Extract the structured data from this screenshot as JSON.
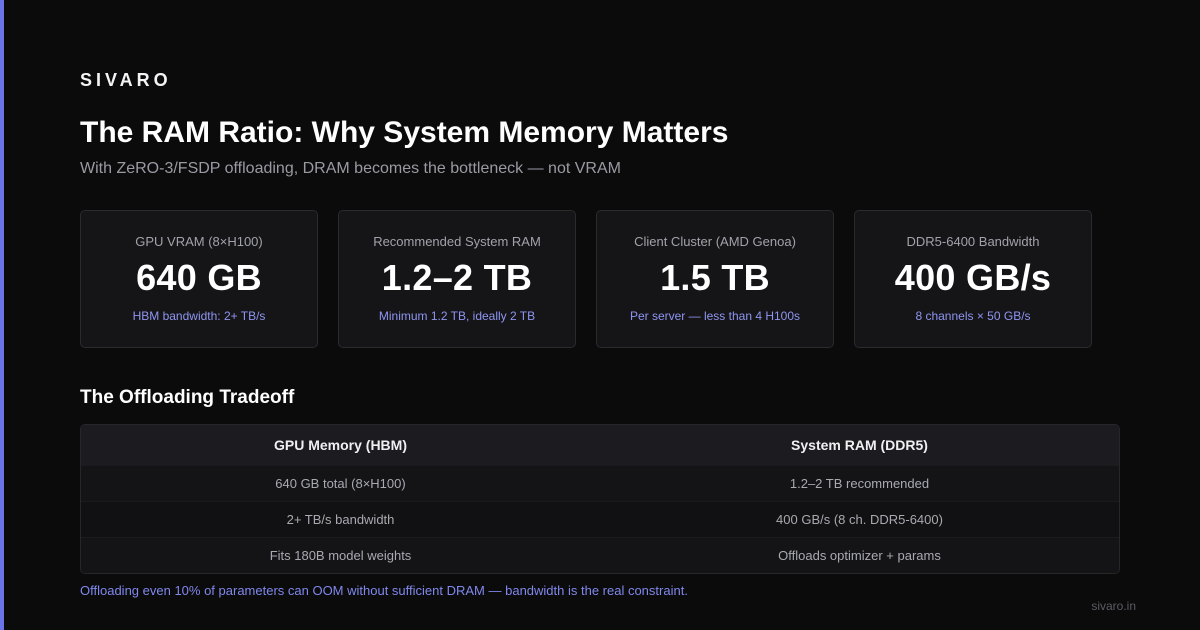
{
  "brand": "SIVARO",
  "title": "The RAM Ratio: Why System Memory Matters",
  "subtitle": "With ZeRO-3/FSDP offloading, DRAM becomes the bottleneck — not VRAM",
  "colors": {
    "background": "#0b0b0c",
    "accent": "#6b74e6",
    "note": "#8f95f0",
    "card": "#151518"
  },
  "cards": [
    {
      "label": "GPU VRAM (8×H100)",
      "value": "640 GB",
      "note": "HBM bandwidth: 2+ TB/s"
    },
    {
      "label": "Recommended System RAM",
      "value": "1.2–2 TB",
      "note": "Minimum 1.2 TB, ideally 2 TB"
    },
    {
      "label": "Client Cluster (AMD Genoa)",
      "value": "1.5 TB",
      "note": "Per server — less than 4 H100s"
    },
    {
      "label": "DDR5-6400 Bandwidth",
      "value": "400 GB/s",
      "note": "8 channels × 50 GB/s"
    }
  ],
  "section_title": "The Offloading Tradeoff",
  "table": {
    "headers": [
      "GPU Memory (HBM)",
      "System RAM (DDR5)"
    ],
    "rows": [
      [
        "640 GB total (8×H100)",
        "1.2–2 TB recommended"
      ],
      [
        "2+ TB/s bandwidth",
        "400 GB/s (8 ch. DDR5-6400)"
      ],
      [
        "Fits 180B model weights",
        "Offloads optimizer + params"
      ]
    ]
  },
  "footnote": "Offloading even 10% of parameters can OOM without sufficient DRAM — bandwidth is the real constraint.",
  "site": "sivaro.in"
}
